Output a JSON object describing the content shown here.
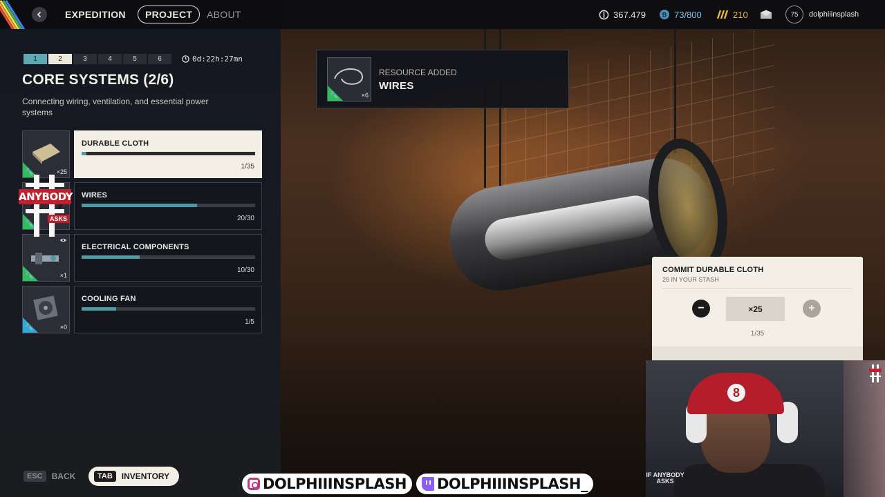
{
  "topbar": {
    "nav": {
      "expedition": "EXPEDITION",
      "project": "PROJECT",
      "about": "ABOUT"
    },
    "stats": {
      "credits": "367.479",
      "capacity": "73/800",
      "tokens": "210"
    },
    "user": {
      "level": "75",
      "name": "dolphiiinsplash"
    }
  },
  "steps": [
    "1",
    "2",
    "3",
    "4",
    "5",
    "6"
  ],
  "timer": "0d:22h:27mn",
  "stage": {
    "title": "CORE SYSTEMS (2/6)",
    "description": "Connecting wiring, ventilation, and essential power systems"
  },
  "requirements": [
    {
      "name": "DURABLE CLOTH",
      "progress_text": "1/35",
      "fraction": 0.0286,
      "count": "×25",
      "thumb_icon": "cloth-icon",
      "selected": true
    },
    {
      "name": "WIRES",
      "progress_text": "20/30",
      "fraction": 0.667,
      "count": "",
      "thumb_icon": "wires-icon",
      "selected": false
    },
    {
      "name": "ELECTRICAL COMPONENTS",
      "progress_text": "10/30",
      "fraction": 0.333,
      "count": "×1",
      "thumb_icon": "electrical-components-icon",
      "selected": false
    },
    {
      "name": "COOLING FAN",
      "progress_text": "1/5",
      "fraction": 0.2,
      "count": "×0",
      "thumb_icon": "cooling-fan-icon",
      "selected": false
    }
  ],
  "toast": {
    "label": "RESOURCE ADDED",
    "title": "WIRES",
    "count": "×6"
  },
  "commit": {
    "title": "COMMIT DURABLE CLOTH",
    "subtitle": "25 IN YOUR STASH",
    "quantity": "×25",
    "minus": "−",
    "plus": "+",
    "progress": "1/35"
  },
  "bottom": {
    "esc_key": "ESC",
    "back_label": "BACK",
    "tab_key": "TAB",
    "inventory_label": "INVENTORY"
  },
  "overlay": {
    "watermark_main": "ANYBODY",
    "watermark_sub": "ASKS",
    "instagram_handle": "DOLPHIIINSPLASH",
    "twitch_handle": "DOLPHIIINSPLASH_",
    "webcam_brand": "IF ANYBODY ASKS"
  },
  "colors": {
    "progress_fill": "#4e9aa6",
    "step_done": "#5ea8b3",
    "panel_light": "#f3efe6",
    "green_corner": "#2fbf5a",
    "blue_corner": "#2ea9d8",
    "brand_red": "#c21f2c"
  }
}
